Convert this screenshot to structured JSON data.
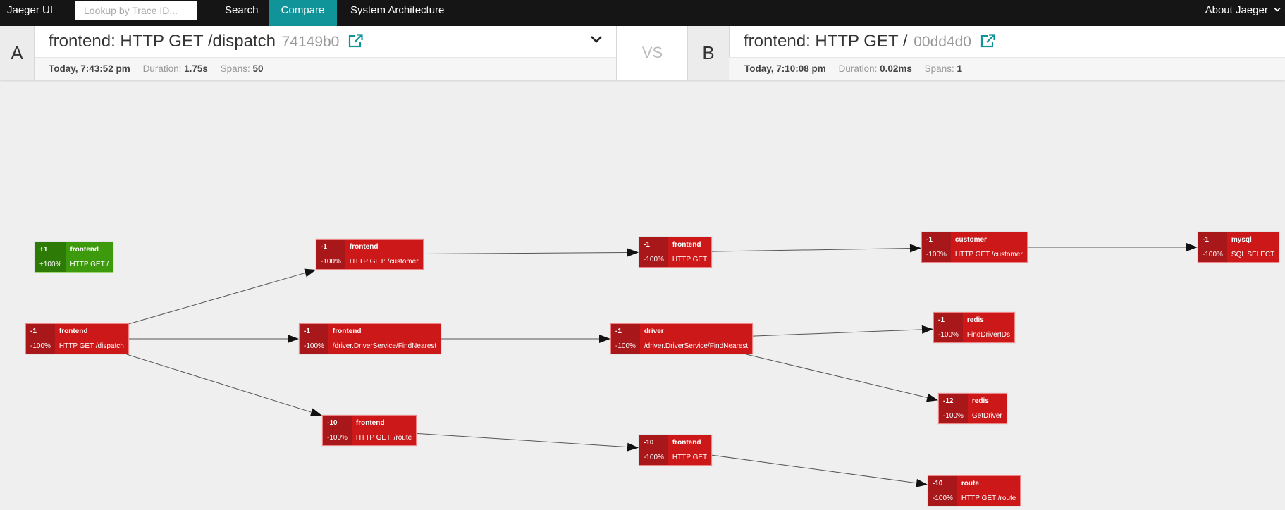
{
  "nav": {
    "brand": "Jaeger UI",
    "lookup_placeholder": "Lookup by Trace ID...",
    "search": "Search",
    "compare": "Compare",
    "system_architecture": "System Architecture",
    "about": "About Jaeger"
  },
  "compare": {
    "a": {
      "letter": "A",
      "title": "frontend: HTTP GET /dispatch",
      "trace_id": "74149b0",
      "timestamp": "Today, 7:43:52 pm",
      "duration_label": "Duration:",
      "duration": "1.75s",
      "spans_label": "Spans:",
      "spans": "50"
    },
    "vs": "VS",
    "b": {
      "letter": "B",
      "title": "frontend: HTTP GET /",
      "trace_id": "00dd4d0",
      "timestamp": "Today, 7:10:08 pm",
      "duration_label": "Duration:",
      "duration": "0.02ms",
      "spans_label": "Spans:",
      "spans": "1"
    }
  },
  "colors": {
    "removed_dark": "#a8181a",
    "removed": "#cc1818",
    "added_dark": "#2e7a07",
    "added": "#3c9a0c",
    "accent": "#11939a"
  },
  "graph": {
    "nodes": [
      {
        "id": "n_root_added",
        "diff": "added",
        "count": "+1",
        "percent": "+100%",
        "service": "frontend",
        "operation": "HTTP GET /"
      },
      {
        "id": "n_dispatch",
        "diff": "removed",
        "count": "-1",
        "percent": "-100%",
        "service": "frontend",
        "operation": "HTTP GET /dispatch"
      },
      {
        "id": "n_fe_customer",
        "diff": "removed",
        "count": "-1",
        "percent": "-100%",
        "service": "frontend",
        "operation": "HTTP GET: /customer"
      },
      {
        "id": "n_fe_findnearest",
        "diff": "removed",
        "count": "-1",
        "percent": "-100%",
        "service": "frontend",
        "operation": "/driver.DriverService/FindNearest"
      },
      {
        "id": "n_fe_route",
        "diff": "removed",
        "count": "-10",
        "percent": "-100%",
        "service": "frontend",
        "operation": "HTTP GET: /route"
      },
      {
        "id": "n_fe_get1",
        "diff": "removed",
        "count": "-1",
        "percent": "-100%",
        "service": "frontend",
        "operation": "HTTP GET"
      },
      {
        "id": "n_driver",
        "diff": "removed",
        "count": "-1",
        "percent": "-100%",
        "service": "driver",
        "operation": "/driver.DriverService/FindNearest"
      },
      {
        "id": "n_fe_get10",
        "diff": "removed",
        "count": "-10",
        "percent": "-100%",
        "service": "frontend",
        "operation": "HTTP GET"
      },
      {
        "id": "n_customer",
        "diff": "removed",
        "count": "-1",
        "percent": "-100%",
        "service": "customer",
        "operation": "HTTP GET /customer"
      },
      {
        "id": "n_redis_ids",
        "diff": "removed",
        "count": "-1",
        "percent": "-100%",
        "service": "redis",
        "operation": "FindDriverIDs"
      },
      {
        "id": "n_redis_get",
        "diff": "removed",
        "count": "-12",
        "percent": "-100%",
        "service": "redis",
        "operation": "GetDriver"
      },
      {
        "id": "n_route",
        "diff": "removed",
        "count": "-10",
        "percent": "-100%",
        "service": "route",
        "operation": "HTTP GET /route"
      },
      {
        "id": "n_mysql",
        "diff": "removed",
        "count": "-1",
        "percent": "-100%",
        "service": "mysql",
        "operation": "SQL SELECT"
      }
    ],
    "edges": [
      {
        "from": "n_dispatch",
        "to": "n_fe_customer"
      },
      {
        "from": "n_dispatch",
        "to": "n_fe_findnearest"
      },
      {
        "from": "n_dispatch",
        "to": "n_fe_route"
      },
      {
        "from": "n_fe_customer",
        "to": "n_fe_get1"
      },
      {
        "from": "n_fe_findnearest",
        "to": "n_driver"
      },
      {
        "from": "n_fe_route",
        "to": "n_fe_get10"
      },
      {
        "from": "n_fe_get1",
        "to": "n_customer"
      },
      {
        "from": "n_customer",
        "to": "n_mysql"
      },
      {
        "from": "n_driver",
        "to": "n_redis_ids"
      },
      {
        "from": "n_driver",
        "to": "n_redis_get"
      },
      {
        "from": "n_fe_get10",
        "to": "n_route"
      }
    ]
  }
}
